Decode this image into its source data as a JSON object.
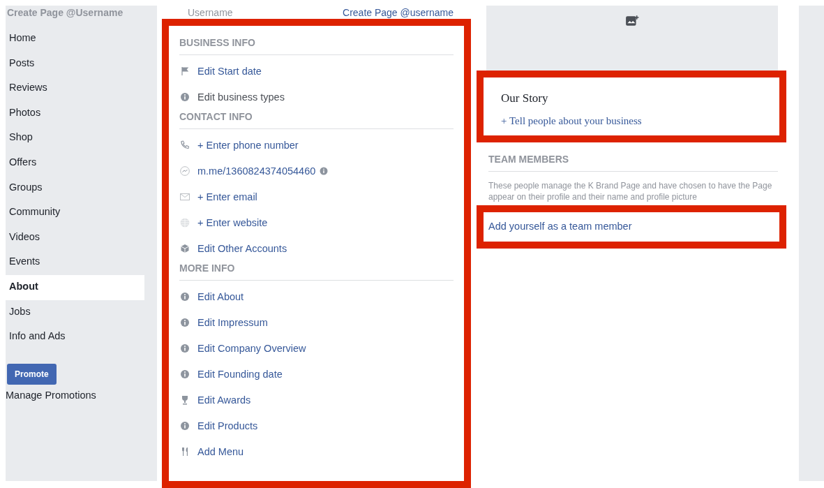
{
  "sidebar": {
    "title": "Create Page @Username",
    "items": [
      {
        "label": "Home",
        "selected": false
      },
      {
        "label": "Posts",
        "selected": false
      },
      {
        "label": "Reviews",
        "selected": false
      },
      {
        "label": "Photos",
        "selected": false
      },
      {
        "label": "Shop",
        "selected": false
      },
      {
        "label": "Offers",
        "selected": false
      },
      {
        "label": "Groups",
        "selected": false
      },
      {
        "label": "Community",
        "selected": false
      },
      {
        "label": "Videos",
        "selected": false
      },
      {
        "label": "Events",
        "selected": false
      },
      {
        "label": "About",
        "selected": true
      },
      {
        "label": "Jobs",
        "selected": false
      },
      {
        "label": "Info and Ads",
        "selected": false
      }
    ],
    "promote_button": "Promote",
    "manage_link": "Manage Promotions"
  },
  "username_row": {
    "label": "Username",
    "link": "Create Page @username"
  },
  "info_panel": {
    "highlighted": true,
    "sections": [
      {
        "heading": "BUSINESS INFO",
        "items": [
          {
            "kind": "flag",
            "text": "Edit Start date",
            "link": true
          },
          {
            "kind": "info",
            "text": "Edit business types",
            "link": false
          }
        ]
      },
      {
        "heading": "CONTACT INFO",
        "items": [
          {
            "kind": "phone",
            "text": "+ Enter phone number",
            "link": true
          },
          {
            "kind": "messenger",
            "text": "m.me/1360824374054460",
            "link": true,
            "info_badge": true
          },
          {
            "kind": "mail",
            "text": "+ Enter email",
            "link": true
          },
          {
            "kind": "globe",
            "text": "+ Enter website",
            "link": true
          },
          {
            "kind": "accounts",
            "text": "Edit Other Accounts",
            "link": true
          }
        ]
      },
      {
        "heading": "MORE INFO",
        "items": [
          {
            "kind": "info",
            "text": "Edit About",
            "link": true
          },
          {
            "kind": "info",
            "text": "Edit Impressum",
            "link": true
          },
          {
            "kind": "info",
            "text": "Edit Company Overview",
            "link": true
          },
          {
            "kind": "info",
            "text": "Edit Founding date",
            "link": true
          },
          {
            "kind": "trophy",
            "text": "Edit Awards",
            "link": true
          },
          {
            "kind": "info",
            "text": "Edit Products",
            "link": true
          },
          {
            "kind": "utensils",
            "text": "Add Menu",
            "link": true
          }
        ]
      }
    ]
  },
  "story": {
    "highlighted": true,
    "title": "Our Story",
    "link": "+ Tell people about your business"
  },
  "team": {
    "heading": "TEAM MEMBERS",
    "description": "These people manage the K Brand Page and have chosen to have the Page appear on their profile and their name and profile picture",
    "link": "Add yourself as a team member",
    "link_highlighted": true
  }
}
